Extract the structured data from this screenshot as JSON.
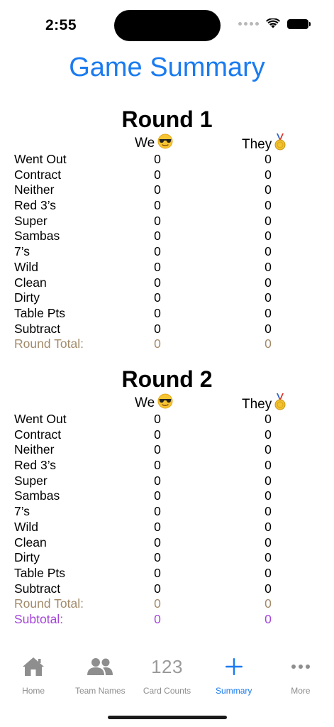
{
  "status_bar": {
    "time": "2:55"
  },
  "page": {
    "title": "Game Summary"
  },
  "teams": {
    "we": "We",
    "they": "They"
  },
  "rounds": [
    {
      "title": "Round 1",
      "rows": [
        {
          "label": "Went Out",
          "we": "0",
          "they": "0"
        },
        {
          "label": "Contract",
          "we": "0",
          "they": "0"
        },
        {
          "label": "Neither",
          "we": "0",
          "they": "0"
        },
        {
          "label": "Red 3’s",
          "we": "0",
          "they": "0"
        },
        {
          "label": "Super",
          "we": "0",
          "they": "0"
        },
        {
          "label": "Sambas",
          "we": "0",
          "they": "0"
        },
        {
          "label": "7’s",
          "we": "0",
          "they": "0"
        },
        {
          "label": "Wild",
          "we": "0",
          "they": "0"
        },
        {
          "label": "Clean",
          "we": "0",
          "they": "0"
        },
        {
          "label": "Dirty",
          "we": "0",
          "they": "0"
        },
        {
          "label": "Table Pts",
          "we": "0",
          "they": "0"
        },
        {
          "label": "Subtract",
          "we": "0",
          "they": "0"
        }
      ],
      "total": {
        "label": "Round Total:",
        "we": "0",
        "they": "0"
      }
    },
    {
      "title": "Round 2",
      "rows": [
        {
          "label": "Went Out",
          "we": "0",
          "they": "0"
        },
        {
          "label": "Contract",
          "we": "0",
          "they": "0"
        },
        {
          "label": "Neither",
          "we": "0",
          "they": "0"
        },
        {
          "label": "Red 3’s",
          "we": "0",
          "they": "0"
        },
        {
          "label": "Super",
          "we": "0",
          "they": "0"
        },
        {
          "label": "Sambas",
          "we": "0",
          "they": "0"
        },
        {
          "label": "7’s",
          "we": "0",
          "they": "0"
        },
        {
          "label": "Wild",
          "we": "0",
          "they": "0"
        },
        {
          "label": "Clean",
          "we": "0",
          "they": "0"
        },
        {
          "label": "Dirty",
          "we": "0",
          "they": "0"
        },
        {
          "label": "Table Pts",
          "we": "0",
          "they": "0"
        },
        {
          "label": "Subtract",
          "we": "0",
          "they": "0"
        }
      ],
      "total": {
        "label": "Round Total:",
        "we": "0",
        "they": "0"
      }
    }
  ],
  "subtotal": {
    "label": "Subtotal:",
    "we": "0",
    "they": "0"
  },
  "tab_bar": {
    "home": "Home",
    "team_names": "Team Names",
    "card_counts_glyph": "123",
    "card_counts": "Card Counts",
    "summary": "Summary",
    "more": "More"
  },
  "colors": {
    "accent": "#1a7bf0",
    "total": "#a38a6a",
    "subtotal": "#a445d8",
    "inactive_tab": "#8e8e8e"
  },
  "icons": {
    "we_emoji": "sunglasses-face-icon",
    "they_emoji": "medal-icon"
  }
}
